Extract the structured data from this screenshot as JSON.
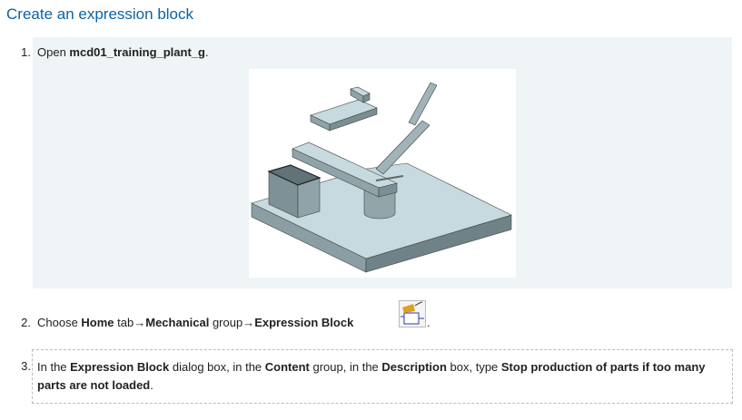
{
  "title": "Create an expression block",
  "steps": [
    {
      "num": "1.",
      "pre": "Open ",
      "bold1": "mcd01_training_plant_g",
      "post": "."
    },
    {
      "num": "2.",
      "pre": "Choose ",
      "home": "Home",
      "tab": " tab→",
      "mech": "Mechanical",
      "group": " group→",
      "eb": "Expression Block",
      "post": ".",
      "icon": "expression-block-icon"
    },
    {
      "num": "3.",
      "a": "In the ",
      "b": "Expression Block",
      "c": " dialog box, in the ",
      "d": "Content",
      "e": " group, in the ",
      "f": "Description",
      "g": " box, type ",
      "h": "Stop production of parts if too many parts are not loaded",
      "i": "."
    }
  ]
}
